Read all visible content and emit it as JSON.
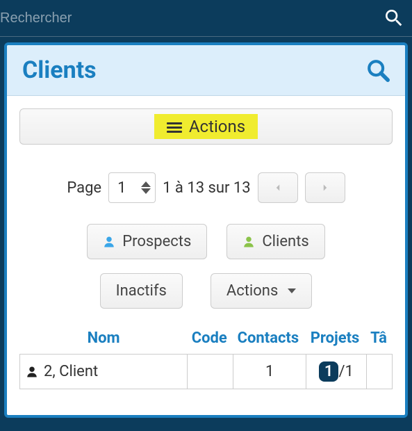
{
  "topbar": {
    "search_placeholder": "Rechercher"
  },
  "panel": {
    "title": "Clients"
  },
  "actions_bar": {
    "label": "Actions"
  },
  "pagination": {
    "page_label": "Page",
    "page_value": "1",
    "range_text": "1 à 13 sur 13"
  },
  "filters": {
    "prospects_label": "Prospects",
    "clients_label": "Clients",
    "inactifs_label": "Inactifs",
    "actions_label": "Actions"
  },
  "table": {
    "headers": {
      "nom": "Nom",
      "code": "Code",
      "contacts": "Contacts",
      "projets": "Projets",
      "taches": "Tâ"
    },
    "rows": [
      {
        "name": "2, Client",
        "code": "",
        "contacts": "1",
        "projects_active": "1",
        "projects_total": "/1"
      }
    ]
  },
  "colors": {
    "accent": "#1a7fc0",
    "dark": "#0c3c5c",
    "highlight": "#f0ec2f",
    "prospect_icon": "#3aa6e8",
    "client_icon": "#8bc34a"
  }
}
